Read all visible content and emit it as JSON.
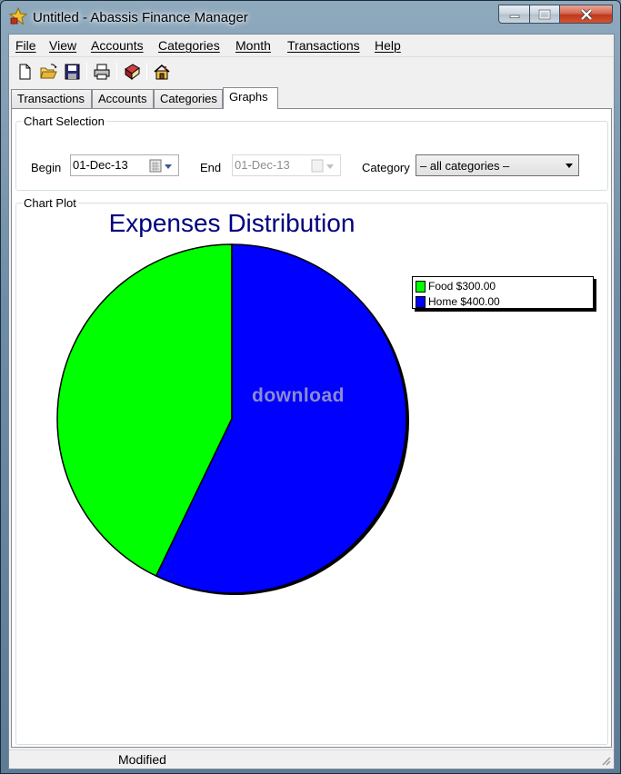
{
  "window": {
    "title": "Untitled - Abassis Finance Manager"
  },
  "menu": {
    "items": [
      "File",
      "View",
      "Accounts",
      "Categories",
      "Month",
      "Transactions",
      "Help"
    ]
  },
  "toolbar": {
    "icons": [
      "new-file-icon",
      "open-folder-icon",
      "save-disk-icon",
      "print-icon",
      "book-icon",
      "home-icon"
    ]
  },
  "tabs": {
    "items": [
      "Transactions",
      "Accounts",
      "Categories",
      "Graphs"
    ],
    "active": "Graphs"
  },
  "chart_selection": {
    "legend": "Chart Selection",
    "begin_label": "Begin",
    "begin_value": "01-Dec-13",
    "end_label": "End",
    "end_value": "01-Dec-13",
    "category_label": "Category",
    "category_value": "– all categories –"
  },
  "chart_plot": {
    "legend": "Chart Plot"
  },
  "watermark": "download",
  "chart_data": {
    "type": "pie",
    "title": "Expenses Distribution",
    "categories": [
      "Food",
      "Home"
    ],
    "values": [
      300,
      400
    ],
    "legend_labels": [
      "Food $300.00",
      "Home $400.00"
    ],
    "colors": [
      "#00ff00",
      "#0000ff"
    ],
    "legend_position": "top-right"
  },
  "status": {
    "text": "Modified"
  }
}
